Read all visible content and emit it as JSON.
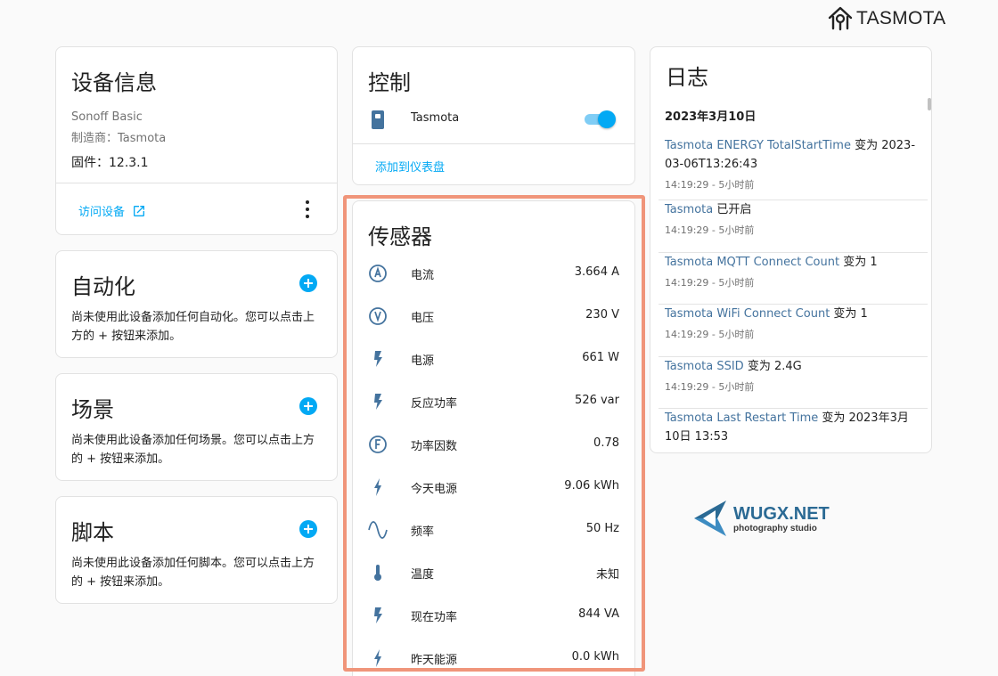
{
  "brand": {
    "name": "TASMOTA"
  },
  "device_info": {
    "title": "设备信息",
    "model": "Sonoff Basic",
    "manufacturer": "制造商：Tasmota",
    "firmware": "固件：12.3.1",
    "visit_label": "访问设备"
  },
  "automation": {
    "title": "自动化",
    "desc": "尚未使用此设备添加任何自动化。您可以点击上方的 + 按钮来添加。"
  },
  "scene": {
    "title": "场景",
    "desc": "尚未使用此设备添加任何场景。您可以点击上方的 + 按钮来添加。"
  },
  "script": {
    "title": "脚本",
    "desc": "尚未使用此设备添加任何脚本。您可以点击上方的 + 按钮来添加。"
  },
  "control": {
    "title": "控制",
    "entity": "Tasmota",
    "switch_on": true,
    "add_dashboard_label": "添加到仪表盘"
  },
  "sensors": {
    "title": "传感器",
    "items": [
      {
        "name": "电流",
        "value": "3.664 A",
        "icon": "current-ac-icon"
      },
      {
        "name": "电压",
        "value": "230 V",
        "icon": "voltage-icon"
      },
      {
        "name": "电源",
        "value": "661 W",
        "icon": "flash-icon"
      },
      {
        "name": "反应功率",
        "value": "526 var",
        "icon": "flash-icon"
      },
      {
        "name": "功率因数",
        "value": "0.78",
        "icon": "power-factor-icon"
      },
      {
        "name": "今天电源",
        "value": "9.06 kWh",
        "icon": "lightning-icon"
      },
      {
        "name": "频率",
        "value": "50 Hz",
        "icon": "sine-wave-icon"
      },
      {
        "name": "温度",
        "value": "未知",
        "icon": "thermometer-icon"
      },
      {
        "name": "现在功率",
        "value": "844 VA",
        "icon": "flash-icon"
      },
      {
        "name": "昨天能源",
        "value": "0.0 kWh",
        "icon": "lightning-icon"
      }
    ]
  },
  "log": {
    "title": "日志",
    "date": "2023年3月10日",
    "entries": [
      {
        "entity": "Tasmota ENERGY TotalStartTime",
        "action": " 变为 2023-03-06T13:26:43",
        "time": "14:19:29 - 5小时前"
      },
      {
        "entity": "Tasmota",
        "action": " 已开启",
        "time": "14:19:29 - 5小时前"
      },
      {
        "entity": "Tasmota MQTT Connect Count",
        "action": " 变为 1",
        "time": "14:19:29 - 5小时前"
      },
      {
        "entity": "Tasmota WiFi Connect Count",
        "action": " 变为 1",
        "time": "14:19:29 - 5小时前"
      },
      {
        "entity": "Tasmota SSID",
        "action": " 变为 2.4G",
        "time": "14:19:29 - 5小时前"
      },
      {
        "entity": "Tasmota Last Restart Time",
        "action": " 变为 2023年3月10日 13:53",
        "time": ""
      }
    ]
  },
  "watermark": {
    "title": "WUGX.NET",
    "subtitle": "photography studio"
  },
  "colors": {
    "accent": "#03a9f4",
    "icon": "#44739e",
    "highlight": "#f0957a"
  }
}
